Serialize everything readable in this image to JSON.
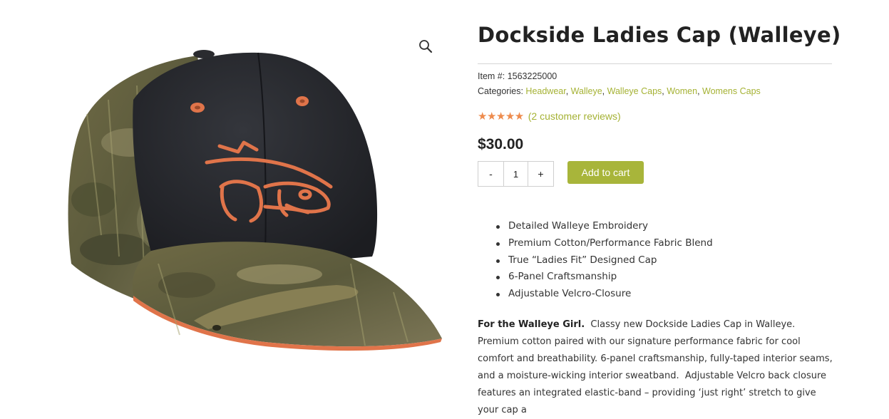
{
  "product": {
    "title": "Dockside Ladies Cap (Walleye)",
    "item_label": "Item #:",
    "item_number": "1563225000",
    "categories_label": "Categories:",
    "categories": [
      "Headwear",
      "Walleye",
      "Walleye Caps",
      "Women",
      "Womens Caps"
    ],
    "category_separator": ", ",
    "rating_stars": 5,
    "review_link": "(2 customer reviews)",
    "price": "$30.00",
    "quantity": {
      "minus": "-",
      "value": "1",
      "plus": "+"
    },
    "add_to_cart": "Add to cart",
    "features": [
      "Detailed Walleye Embroidery",
      "Premium Cotton/Performance Fabric Blend",
      "True “Ladies Fit” Designed Cap",
      "6-Panel Craftsmanship",
      "Adjustable Velcro-Closure"
    ],
    "description_lead": "For the Walleye Girl.",
    "description_body": "  Classy new Dockside Ladies Cap in Walleye. Premium cotton paired with our signature performance fabric for cool comfort and breathability. 6-panel craftsmanship, fully-taped interior seams, and a moisture-wicking interior sweatband.  Adjustable Velcro back closure features an integrated elastic-band – providing ‘just right’ stretch to give your cap a"
  },
  "gallery": {
    "zoom_icon": "magnifier-icon",
    "image": "camo-cap-with-walleye-embroidery"
  },
  "colors": {
    "accent": "#a8b53a",
    "link": "#a5b234",
    "star": "#ee8b4d",
    "embroidery": "#e0744a",
    "crown": "#23252a"
  }
}
